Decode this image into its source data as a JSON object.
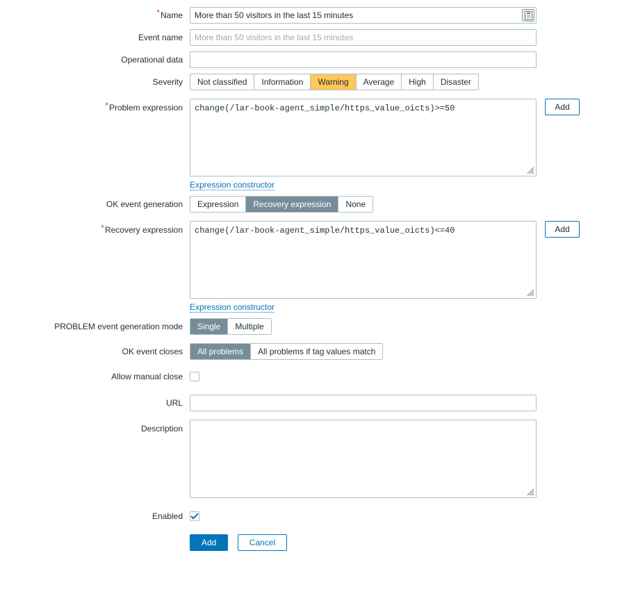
{
  "form": {
    "name": {
      "label": "Name",
      "required": true,
      "value": "More than 50 visitors in the last 15 minutes",
      "button_icon": "clipboard-icon"
    },
    "event_name": {
      "label": "Event name",
      "value": "",
      "placeholder": "More than 50 visitors in the last 15 minutes"
    },
    "operational_data": {
      "label": "Operational data",
      "value": "",
      "placeholder": ""
    },
    "severity": {
      "label": "Severity",
      "options": [
        "Not classified",
        "Information",
        "Warning",
        "Average",
        "High",
        "Disaster"
      ],
      "selected": "Warning",
      "selected_color": "#ffc859"
    },
    "problem_expression": {
      "label": "Problem expression",
      "required": true,
      "value": "change(/lar-book-agent_simple/https_value_oicts)>=50",
      "add_label": "Add",
      "constructor_link": "Expression constructor"
    },
    "ok_event_generation": {
      "label": "OK event generation",
      "options": [
        "Expression",
        "Recovery expression",
        "None"
      ],
      "selected": "Recovery expression"
    },
    "recovery_expression": {
      "label": "Recovery expression",
      "required": true,
      "value": "change(/lar-book-agent_simple/https_value_oicts)<=40",
      "add_label": "Add",
      "constructor_link": "Expression constructor"
    },
    "problem_event_generation_mode": {
      "label": "PROBLEM event generation mode",
      "options": [
        "Single",
        "Multiple"
      ],
      "selected": "Single"
    },
    "ok_event_closes": {
      "label": "OK event closes",
      "options": [
        "All problems",
        "All problems if tag values match"
      ],
      "selected": "All problems"
    },
    "allow_manual_close": {
      "label": "Allow manual close",
      "checked": false
    },
    "url": {
      "label": "URL",
      "value": "",
      "placeholder": ""
    },
    "description": {
      "label": "Description",
      "value": "",
      "placeholder": ""
    },
    "enabled": {
      "label": "Enabled",
      "checked": true
    }
  },
  "footer": {
    "submit_label": "Add",
    "cancel_label": "Cancel"
  },
  "colors": {
    "accent": "#0275b8",
    "selected_toggle": "#768d99",
    "warning": "#ffc859",
    "required_asterisk": "#e33734",
    "border": "#aebfc9"
  }
}
